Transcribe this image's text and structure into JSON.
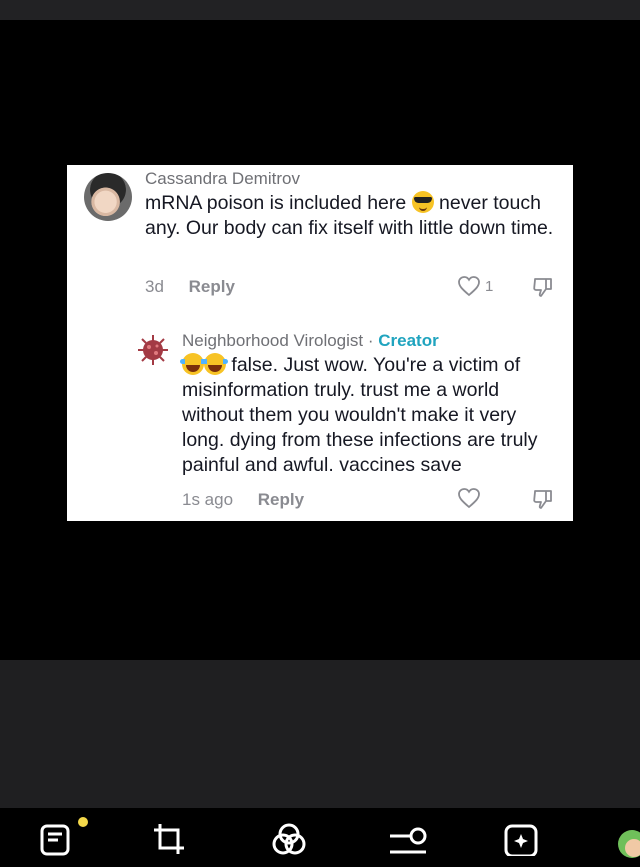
{
  "comments": [
    {
      "author": "Cassandra Demitrov",
      "text_before_emoji": "mRNA poison is included here ",
      "emoji": "sunglasses-emoji",
      "text_after_emoji": " never touch any. Our body can fix itself with little down time.",
      "time": "3d",
      "reply_label": "Reply",
      "likes": "1"
    },
    {
      "author": "Neighborhood Virologist",
      "separator": " · ",
      "badge": "Creator",
      "emoji": "tears-of-joy-emoji",
      "text": " false. Just wow. You're a victim of misinformation truly. trust me a world without them you wouldn't make it very long. dying from these infections are truly painful and awful. vaccines save",
      "time": "1s ago",
      "reply_label": "Reply"
    }
  ],
  "toolbar_icons": [
    "edit-text-icon",
    "crop-icon",
    "filters-icon",
    "adjust-icon",
    "enhance-icon",
    "avatar-icon"
  ],
  "colors": {
    "creator": "#20a4bf",
    "notification_dot": "#f4d84a"
  }
}
